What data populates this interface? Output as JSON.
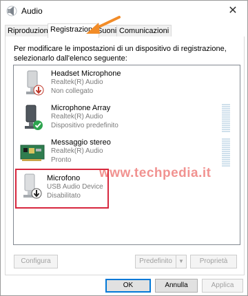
{
  "window": {
    "title": "Audio",
    "close_glyph": "✕"
  },
  "tabs": [
    {
      "label": "Riproduzione",
      "active": false
    },
    {
      "label": "Registrazione",
      "active": true
    },
    {
      "label": "Suoni",
      "active": false
    },
    {
      "label": "Comunicazioni",
      "active": false
    }
  ],
  "instructions": "Per modificare le impostazioni di un dispositivo di registrazione, selezionarlo dall'elenco seguente:",
  "devices": [
    {
      "name": "Headset Microphone",
      "driver": "Realtek(R) Audio",
      "status": "Non collegato",
      "icon": "microphone-icon",
      "badge": "red-down-arrow-icon"
    },
    {
      "name": "Microphone Array",
      "driver": "Realtek(R) Audio",
      "status": "Dispositivo predefinito",
      "icon": "microphone-icon",
      "badge": "green-check-icon"
    },
    {
      "name": "Messaggio stereo",
      "driver": "Realtek(R) Audio",
      "status": "Pronto",
      "icon": "sound-card-icon"
    },
    {
      "name": "Microfono",
      "driver": "USB Audio Device",
      "status": "Disabilitato",
      "icon": "microphone-icon",
      "badge": "down-arrow-icon"
    }
  ],
  "watermark": {
    "text_a": "www",
    "text_b": "techpedia",
    "text_c": "it"
  },
  "panel_buttons": {
    "configure": "Configura",
    "default": "Predefinito",
    "properties": "Proprietà"
  },
  "dialog_buttons": {
    "ok": "OK",
    "cancel": "Annulla",
    "apply": "Applica"
  },
  "colors": {
    "highlight_border": "#d7263d",
    "arrow": "#f28c28",
    "watermark": "#e53935",
    "default_button_border": "#0078d7"
  }
}
